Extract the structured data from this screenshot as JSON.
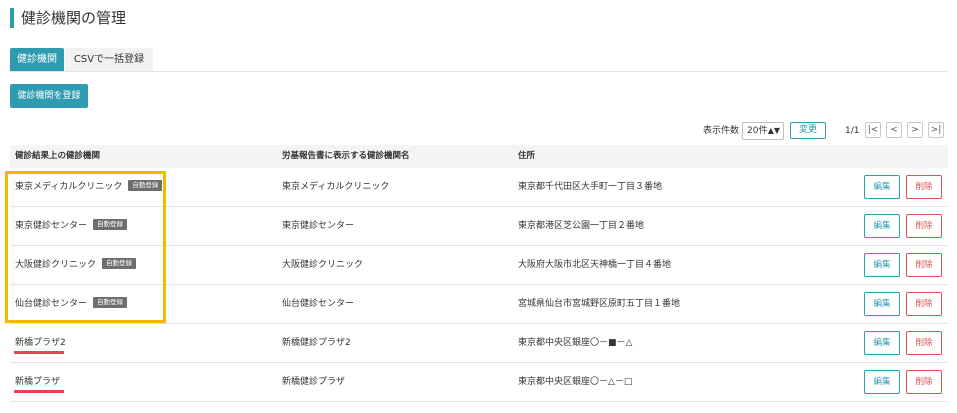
{
  "page": {
    "title": "健診機関の管理"
  },
  "tabs": [
    {
      "label": "健診機関"
    },
    {
      "label": "CSVで一括登録"
    }
  ],
  "actions": {
    "register_label": "健診機関を登録"
  },
  "pager": {
    "per_page_label": "表示件数",
    "per_page_value": "20件",
    "change_label": "変更",
    "page_info": "1/1",
    "first": "|<",
    "prev": "<",
    "next": ">",
    "last": ">|"
  },
  "table": {
    "headers": [
      "健診結果上の健診機関",
      "労基報告書に表示する健診機関名",
      "住所"
    ],
    "edit_label": "編集",
    "delete_label": "削除",
    "rows": [
      {
        "name": "東京メディカルクリニック",
        "badge": "自動登録",
        "report_name": "東京メディカルクリニック",
        "address": "東京都千代田区大手町一丁目３番地"
      },
      {
        "name": "東京健診センター",
        "badge": "自動登録",
        "report_name": "東京健診センター",
        "address": "東京都港区芝公園一丁目２番地"
      },
      {
        "name": "大阪健診クリニック",
        "badge": "自動登録",
        "report_name": "大阪健診クリニック",
        "address": "大阪府大阪市北区天神橋一丁目４番地"
      },
      {
        "name": "仙台健診センター",
        "badge": "自動登録",
        "report_name": "仙台健診センター",
        "address": "宮城県仙台市宮城野区原町五丁目１番地"
      },
      {
        "name": "新橋プラザ2",
        "badge": "",
        "report_name": "新橋健診プラザ2",
        "address": "東京都中央区銀座〇－■－△"
      },
      {
        "name": "新橋プラザ",
        "badge": "",
        "report_name": "新橋健診プラザ",
        "address": "東京都中央区銀座〇－△－□"
      }
    ]
  },
  "annotations": {
    "highlight_color": "#f5b800",
    "underline_color": "#e8424f"
  },
  "colors": {
    "accent": "#2f9bb0",
    "danger": "#d9534f",
    "badge": "#6e6e6e"
  }
}
